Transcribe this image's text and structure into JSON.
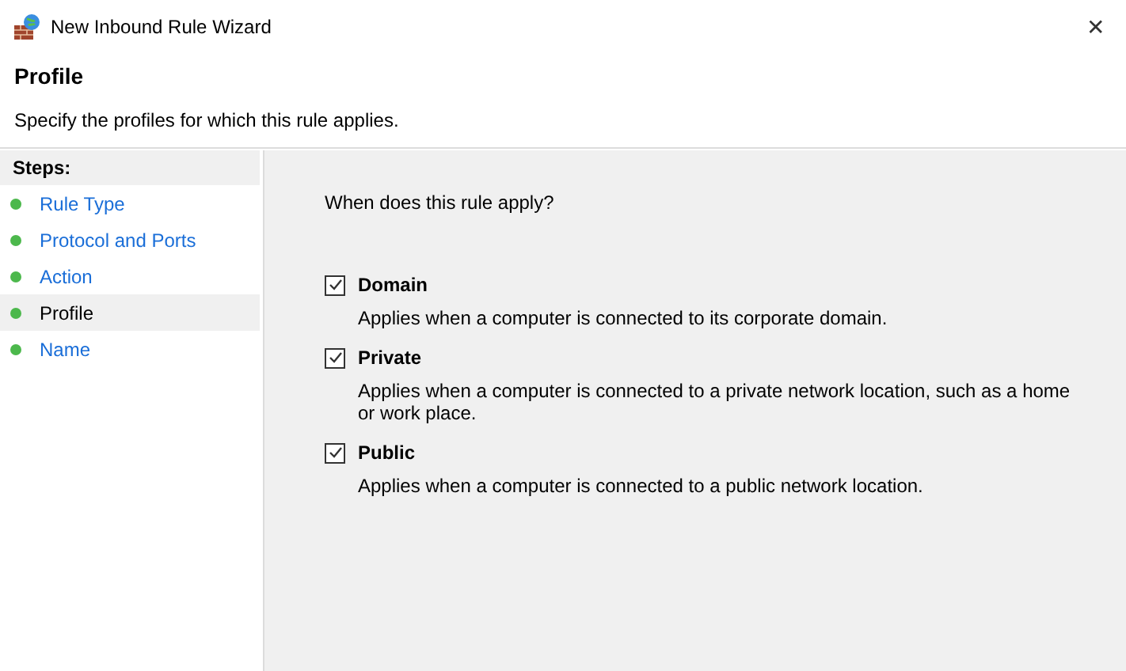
{
  "window": {
    "title": "New Inbound Rule Wizard",
    "close": "✕"
  },
  "header": {
    "title": "Profile",
    "subtitle": "Specify the profiles for which this rule applies."
  },
  "steps": {
    "heading": "Steps:",
    "items": [
      {
        "label": "Rule Type",
        "selected": false
      },
      {
        "label": "Protocol and Ports",
        "selected": false
      },
      {
        "label": "Action",
        "selected": false
      },
      {
        "label": "Profile",
        "selected": true
      },
      {
        "label": "Name",
        "selected": false
      }
    ]
  },
  "content": {
    "question": "When does this rule apply?",
    "options": [
      {
        "label": "Domain",
        "checked": true,
        "description": "Applies when a computer is connected to its corporate domain."
      },
      {
        "label": "Private",
        "checked": true,
        "description": "Applies when a computer is connected to a private network location, such as a home or work place."
      },
      {
        "label": "Public",
        "checked": true,
        "description": "Applies when a computer is connected to a public network location."
      }
    ]
  }
}
